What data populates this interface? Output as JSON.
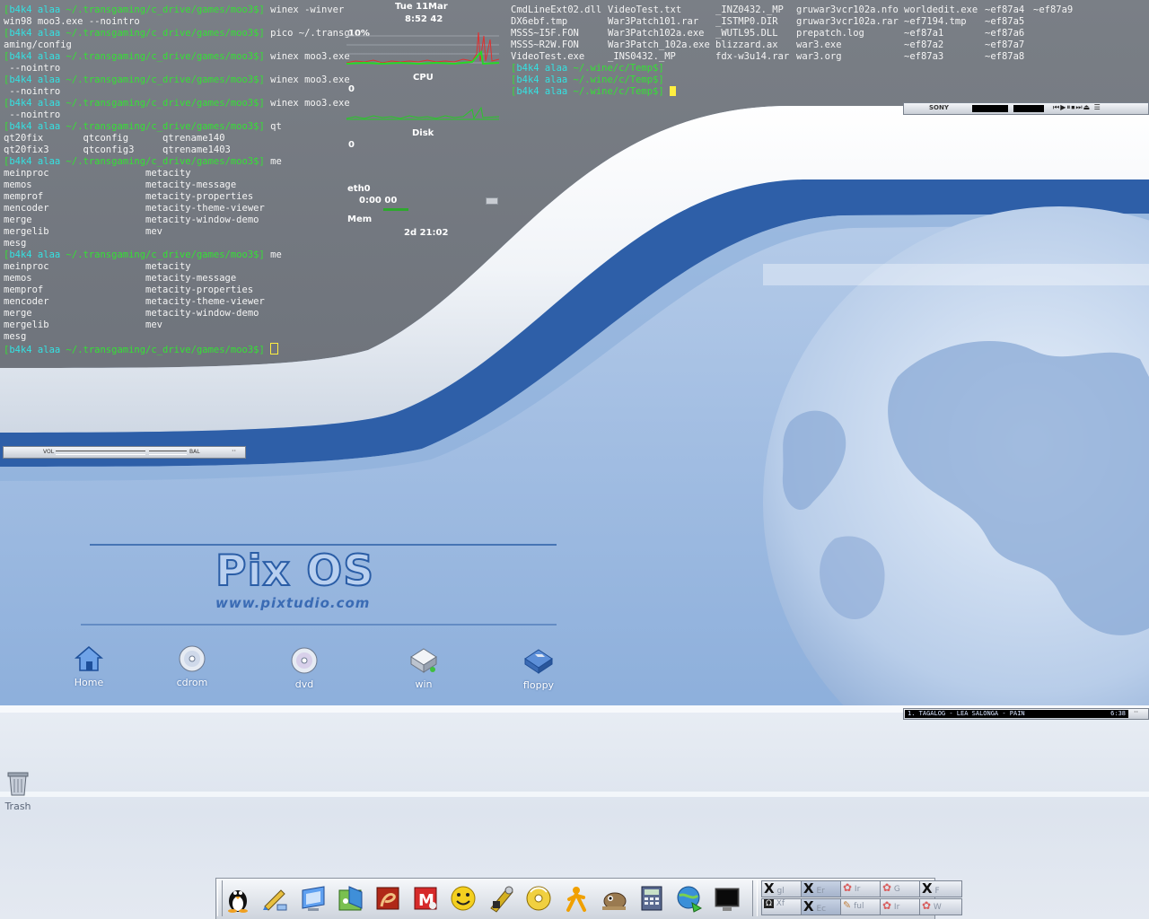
{
  "terminal_left": {
    "lines": [
      {
        "segs": [
          [
            "g",
            "["
          ],
          [
            "c",
            "b4k4 alaa "
          ],
          [
            "g",
            "~/.transgaming/c_drive/games/moo3$"
          ],
          [
            "g",
            "]"
          ],
          [
            "w",
            " winex -winver"
          ]
        ]
      },
      {
        "segs": [
          [
            "w",
            "win98 moo3.exe --nointro"
          ]
        ]
      },
      {
        "segs": [
          [
            "g",
            "["
          ],
          [
            "c",
            "b4k4 alaa "
          ],
          [
            "g",
            "~/.transgaming/c_drive/games/moo3$"
          ],
          [
            "g",
            "]"
          ],
          [
            "w",
            " pico ~/.transg"
          ]
        ]
      },
      {
        "segs": [
          [
            "w",
            "aming/config"
          ]
        ]
      },
      {
        "segs": [
          [
            "g",
            "["
          ],
          [
            "c",
            "b4k4 alaa "
          ],
          [
            "g",
            "~/.transgaming/c_drive/games/moo3$"
          ],
          [
            "g",
            "]"
          ],
          [
            "w",
            " winex moo3.exe"
          ]
        ]
      },
      {
        "segs": [
          [
            "w",
            " --nointro"
          ]
        ]
      },
      {
        "segs": [
          [
            "g",
            "["
          ],
          [
            "c",
            "b4k4 alaa "
          ],
          [
            "g",
            "~/.transgaming/c_drive/games/moo3$"
          ],
          [
            "g",
            "]"
          ],
          [
            "w",
            " winex moo3.exe"
          ]
        ]
      },
      {
        "segs": [
          [
            "w",
            " --nointro"
          ]
        ]
      },
      {
        "segs": [
          [
            "g",
            "["
          ],
          [
            "c",
            "b4k4 alaa "
          ],
          [
            "g",
            "~/.transgaming/c_drive/games/moo3$"
          ],
          [
            "g",
            "]"
          ],
          [
            "w",
            " winex moo3.exe"
          ]
        ]
      },
      {
        "segs": [
          [
            "w",
            " --nointro"
          ]
        ]
      },
      {
        "segs": [
          [
            "g",
            "["
          ],
          [
            "c",
            "b4k4 alaa "
          ],
          [
            "g",
            "~/.transgaming/c_drive/games/moo3$"
          ],
          [
            "g",
            "]"
          ],
          [
            "w",
            " qt"
          ]
        ]
      },
      {
        "segs": [
          [
            "w",
            "qt20fix       qtconfig      qtrename140"
          ]
        ]
      },
      {
        "segs": [
          [
            "w",
            "qt20fix3      qtconfig3     qtrename1403"
          ]
        ]
      },
      {
        "segs": [
          [
            "g",
            "["
          ],
          [
            "c",
            "b4k4 alaa "
          ],
          [
            "g",
            "~/.transgaming/c_drive/games/moo3$"
          ],
          [
            "g",
            "]"
          ],
          [
            "w",
            " me"
          ]
        ]
      },
      {
        "segs": [
          [
            "w",
            "meinproc                 metacity"
          ]
        ]
      },
      {
        "segs": [
          [
            "w",
            "memos                    metacity-message"
          ]
        ]
      },
      {
        "segs": [
          [
            "w",
            "memprof                  metacity-properties"
          ]
        ]
      },
      {
        "segs": [
          [
            "w",
            "mencoder                 metacity-theme-viewer"
          ]
        ]
      },
      {
        "segs": [
          [
            "w",
            "merge                    metacity-window-demo"
          ]
        ]
      },
      {
        "segs": [
          [
            "w",
            "mergelib                 mev"
          ]
        ]
      },
      {
        "segs": [
          [
            "w",
            "mesg"
          ]
        ]
      },
      {
        "segs": [
          [
            "g",
            "["
          ],
          [
            "c",
            "b4k4 alaa "
          ],
          [
            "g",
            "~/.transgaming/c_drive/games/moo3$"
          ],
          [
            "g",
            "]"
          ],
          [
            "w",
            " me"
          ]
        ]
      },
      {
        "segs": [
          [
            "w",
            "meinproc                 metacity"
          ]
        ]
      },
      {
        "segs": [
          [
            "w",
            "memos                    metacity-message"
          ]
        ]
      },
      {
        "segs": [
          [
            "w",
            "memprof                  metacity-properties"
          ]
        ]
      },
      {
        "segs": [
          [
            "w",
            "mencoder                 metacity-theme-viewer"
          ]
        ]
      },
      {
        "segs": [
          [
            "w",
            "merge                    metacity-window-demo"
          ]
        ]
      },
      {
        "segs": [
          [
            "w",
            "mergelib                 mev"
          ]
        ]
      },
      {
        "segs": [
          [
            "w",
            "mesg"
          ]
        ]
      },
      {
        "segs": [
          [
            "g",
            "["
          ],
          [
            "c",
            "b4k4 alaa "
          ],
          [
            "g",
            "~/.transgaming/c_drive/games/moo3$"
          ],
          [
            "g",
            "]"
          ],
          [
            "w",
            " "
          ]
        ],
        "cursor": "box"
      }
    ]
  },
  "terminal_right": {
    "rows": [
      [
        "CmdLineExt02.dll",
        "VideoTest.txt",
        "_INZ0432._MP",
        "gruwar3vcr102a.nfo",
        "worldedit.exe",
        "~ef87a4",
        "~ef87a9"
      ],
      [
        "DX6ebf.tmp",
        "War3Patch101.rar",
        "_ISTMP0.DIR",
        "gruwar3vcr102a.rar",
        "~ef7194.tmp",
        "~ef87a5",
        ""
      ],
      [
        "MSSS~I5F.FON",
        "War3Patch102a.exe",
        "_WUTL95.DLL",
        "prepatch.log",
        "~ef87a1",
        "~ef87a6",
        ""
      ],
      [
        "MSSS~R2W.FON",
        "War3Patch_102a.exe",
        "blizzard.ax",
        "war3.exe",
        "~ef87a2",
        "~ef87a7",
        ""
      ],
      [
        "VideoTest.exe",
        "_INS0432._MP",
        "fdx-w3u14.rar",
        "war3.org",
        "~ef87a3",
        "~ef87a8",
        ""
      ]
    ],
    "prompts": [
      {
        "open": "[",
        "user": "b4k4 alaa ",
        "path": "~/.wine/c/Temp$",
        "close": "]"
      },
      {
        "open": "[",
        "user": "b4k4 alaa ",
        "path": "~/.wine/c/Temp$",
        "close": "]"
      },
      {
        "open": "[",
        "user": "b4k4 alaa ",
        "path": "~/.wine/c/Temp$",
        "close": "]"
      }
    ]
  },
  "sysmon": {
    "date": "Tue 11Mar",
    "time": "8:52 42",
    "cpu_scale": "10%",
    "cpu_label": "CPU",
    "cpu_zero": "0",
    "disk_label": "Disk",
    "disk_zero": "0",
    "net_label": "eth0",
    "net_time": "0:00 00",
    "mem_label": "Mem",
    "uptime": "2d 21:02"
  },
  "mixer": {
    "vol_label": "VOL",
    "bal_label": "BAL"
  },
  "player_top": {
    "brand": "SONY"
  },
  "player_bottom": {
    "track": "1. TAGALOG - LEA SALONGA - PAIN",
    "time": "6:38"
  },
  "wallpaper": {
    "logo": "Pix OS",
    "url": "www.pixtudio.com"
  },
  "desktop_icons": [
    {
      "label": "Home",
      "icon": "home-icon"
    },
    {
      "label": "cdrom",
      "icon": "cdrom-icon"
    },
    {
      "label": "dvd",
      "icon": "dvd-icon"
    },
    {
      "label": "win",
      "icon": "drive-icon"
    },
    {
      "label": "floppy",
      "icon": "floppy-icon"
    },
    {
      "label": "Trash",
      "icon": "trash-icon"
    }
  ],
  "taskbar": {
    "launchers": [
      "tux-icon",
      "paint-icon",
      "monitor-icon",
      "file-manager-icon",
      "red-app-icon",
      "mail-icon",
      "smiley-icon",
      "wrench-icon",
      "cd-player-icon",
      "aim-icon",
      "gimp-icon",
      "calculator-icon",
      "network-icon",
      "terminal-icon"
    ],
    "windows": [
      {
        "label": "gl",
        "icon": "x-icon"
      },
      {
        "label": "Er",
        "icon": "x-icon"
      },
      {
        "label": "Ir",
        "icon": "fish-icon"
      },
      {
        "label": "G",
        "icon": "fish-icon"
      },
      {
        "label": "F",
        "icon": "x-icon"
      },
      {
        "label": "Xf",
        "icon": "xterm-icon"
      },
      {
        "label": "Ec",
        "icon": "x-icon"
      },
      {
        "label": "ful",
        "icon": "brush-icon"
      },
      {
        "label": "Ir",
        "icon": "fish-icon"
      },
      {
        "label": "W",
        "icon": "fish-icon"
      }
    ]
  },
  "colors": {
    "prompt_green": "#35e035",
    "prompt_cyan": "#34e2e2",
    "cursor": "#ffee40",
    "desktop_gray": "#757b85",
    "wall_blue": "#2a5da6"
  }
}
